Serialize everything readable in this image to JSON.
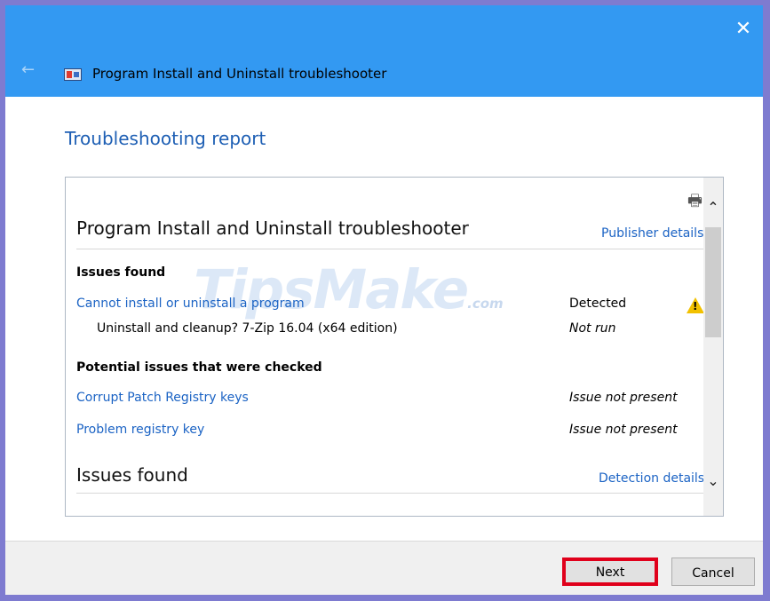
{
  "window": {
    "title": "Program Install and Uninstall troubleshooter",
    "close_glyph": "✕",
    "back_glyph": "←"
  },
  "report": {
    "heading": "Troubleshooting report",
    "title": "Program Install and Uninstall troubleshooter",
    "publisher_link": "Publisher details",
    "issues_label": "Issues found",
    "issue_name": "Cannot install or uninstall a program",
    "issue_status": "Detected",
    "sub_issue": "Uninstall and cleanup? 7-Zip 16.04 (x64 edition)",
    "sub_status": "Not run",
    "checked_label": "Potential issues that were checked",
    "checked": [
      {
        "name": "Corrupt Patch Registry keys",
        "status": "Issue not present"
      },
      {
        "name": "Problem registry key",
        "status": "Issue not present"
      }
    ],
    "section_title": "Issues found",
    "detection_link": "Detection details"
  },
  "footer": {
    "next": "Next",
    "cancel": "Cancel"
  },
  "watermark": {
    "text": "TipsMake",
    "suffix": ".com"
  },
  "colors": {
    "title_bar": "#3399f2",
    "link": "#1b63c4",
    "next_highlight": "#e0001b"
  }
}
